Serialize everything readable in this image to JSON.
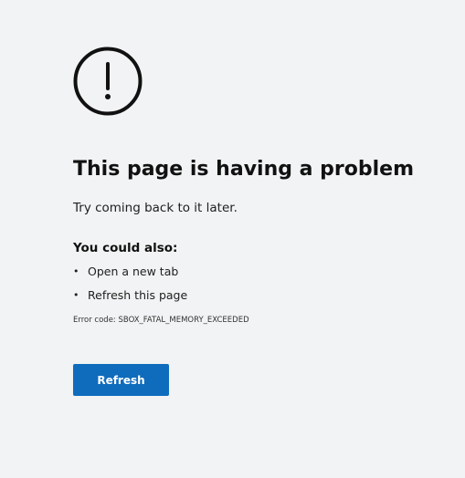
{
  "error_page": {
    "title": "This page is having a problem",
    "subtitle": "Try coming back to it later.",
    "also_heading": "You could also:",
    "suggestions": [
      "Open a new tab",
      "Refresh this page"
    ],
    "error_code": "Error code: SBOX_FATAL_MEMORY_EXCEEDED",
    "refresh_label": "Refresh",
    "icon": "exclamation-circle-icon"
  },
  "colors": {
    "background": "#f1f3f4",
    "button": "#0f6cbd",
    "button_text": "#ffffff"
  }
}
